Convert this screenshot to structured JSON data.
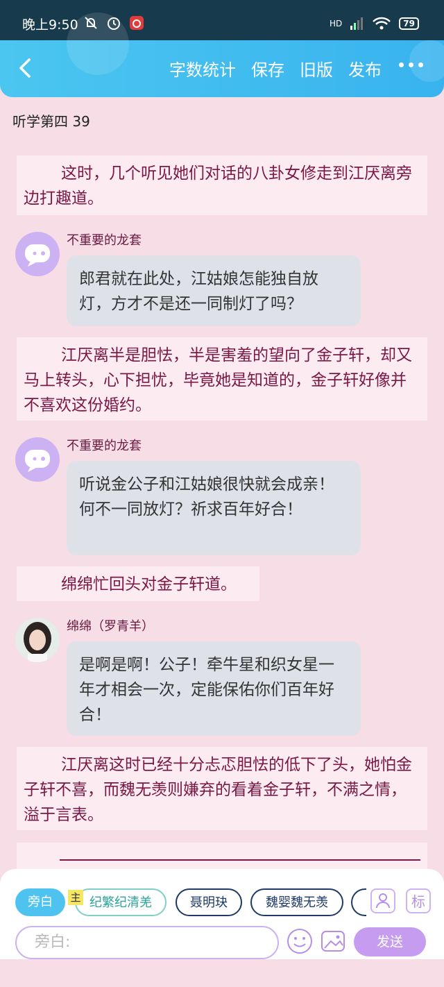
{
  "status_bar": {
    "time": "晚上9:50",
    "network": "HD",
    "battery": "79"
  },
  "header": {
    "back_icon": "chevron-left-icon",
    "actions": [
      "字数统计",
      "保存",
      "旧版",
      "发布"
    ],
    "more_icon": "more-dots-icon"
  },
  "chapter_title": "听学第四 39",
  "blocks": [
    {
      "type": "narration",
      "text": "这时，几个听见她们对话的八卦女修走到江厌离旁边打趣道。"
    },
    {
      "type": "dialog",
      "speaker": "不重要的龙套",
      "text": "郎君就在此处，江姑娘怎能独自放灯，方才不是还一同制灯了吗？"
    },
    {
      "type": "narration",
      "text": "江厌离半是胆怯，半是害羞的望向了金子轩，却又马上转头，心下担忧，毕竟她是知道的，金子轩好像并不喜欢这份婚约。"
    },
    {
      "type": "dialog",
      "speaker": "不重要的龙套",
      "text": "听说金公子和江姑娘很快就会成亲！何不一同放灯？祈求百年好合！"
    },
    {
      "type": "narration",
      "text": "绵绵忙回头对金子轩道。"
    },
    {
      "type": "dialog",
      "speaker": "绵绵（罗青羊）",
      "text": "是啊是啊！公子！牵牛星和织女星一年才相会一次，定能保佑你们百年好合！"
    },
    {
      "type": "narration",
      "text": "江厌离这时已经十分忐忑胆怯的低下了头，她怕金子轩不喜，而魏无羡则嫌弃的看着金子轩，不满之情，溢于言表。"
    }
  ],
  "toolbar": {
    "roles": [
      "旁白",
      "纪繁纪清羌",
      "聂明玦",
      "魏婴魏无羡"
    ],
    "lead_badge": "主",
    "input_placeholder": "旁白:",
    "send_label": "发送",
    "side_label": "标"
  },
  "colors": {
    "accent": "#4fc3f0",
    "narration_text": "#7a1745",
    "send_button": "#c69cf0"
  }
}
